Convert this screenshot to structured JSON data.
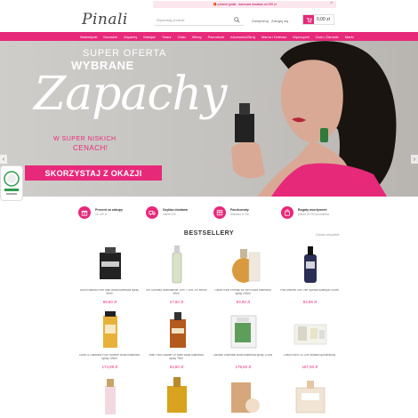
{
  "topbar": {
    "text": "🎁 prezent gratis · darmowa dostawa od 199 zł",
    "close": "×"
  },
  "header": {
    "logo": "Pinali",
    "search_placeholder": "Wyszukaj produkt",
    "account": "Zarejestruj",
    "login": "Zaloguj się",
    "cart_total": "0,00 zł"
  },
  "nav": [
    "Walentynki",
    "Damskie",
    "Zapachy",
    "Makijaż",
    "Twarz",
    "Ciało",
    "Włosy",
    "Paznokcie",
    "Akcesoria/Zdrój",
    "Mama i Dziecko",
    "Mężczyźni",
    "Dom i Zdrowie",
    "Marki"
  ],
  "hero": {
    "title1": "SUPER OFERTA",
    "title2": "WYBRANE",
    "script": "Zapachy",
    "pink1": "W SUPER NISKICH",
    "pink2": "CENACH!",
    "cta": "SKORZYSTAJ Z OKAZJI"
  },
  "features": [
    {
      "title": "Prezent za zakupy",
      "sub": "od 149 zł"
    },
    {
      "title": "Szybka dostawa",
      "sub": "nawet 24h"
    },
    {
      "title": "Paczkomaty",
      "sub": "dostawa w 24h"
    },
    {
      "title": "Bogaty asortyment",
      "sub": "ponad 15 000 produktów"
    }
  ],
  "section": {
    "title": "BESTSELLERY",
    "see_all": "Zobacz wszystkie"
  },
  "products": [
    {
      "name": "Bruno Banani Pure Man woda toaletowa spray 50ml",
      "price": "69,50 zł",
      "type": "black-square"
    },
    {
      "name": "The Ordinary Niacinamide 10% + Zinc 1% serum 30ml",
      "price": "27,50 zł",
      "type": "serum"
    },
    {
      "name": "Calvin Klein Eternity for Men woda toaletowa spray 100ml",
      "price": "83,90 zł",
      "type": "round-amber"
    },
    {
      "name": "Paul Mitchell Tea Tree Special szampon 300ml",
      "price": "83,99 zł",
      "type": "pump"
    },
    {
      "name": "Dolce & Gabbana Pour Homme woda toaletowa spray 125ml",
      "price": "174,99 zł",
      "type": "tall-gold"
    },
    {
      "name": "Jean Paul Gaultier Le Male woda toaletowa spray 75ml",
      "price": "53,50 zł",
      "type": "amber-rect"
    },
    {
      "name": "Lacoste Essential woda toaletowa spray 125ml",
      "price": "178,50 zł",
      "type": "green-box"
    },
    {
      "name": "Calvin Klein CK One zestaw upominkowy",
      "price": "187,50 zł",
      "type": "gift-set"
    },
    {
      "name": "",
      "price": "",
      "type": "pink-tall"
    },
    {
      "name": "",
      "price": "",
      "type": "gold-square"
    },
    {
      "name": "",
      "price": "",
      "type": "tan-box"
    },
    {
      "name": "",
      "price": "",
      "type": "chloe"
    }
  ],
  "colors": {
    "accent": "#e7297a",
    "hero_bg": "#c8c6c3"
  }
}
